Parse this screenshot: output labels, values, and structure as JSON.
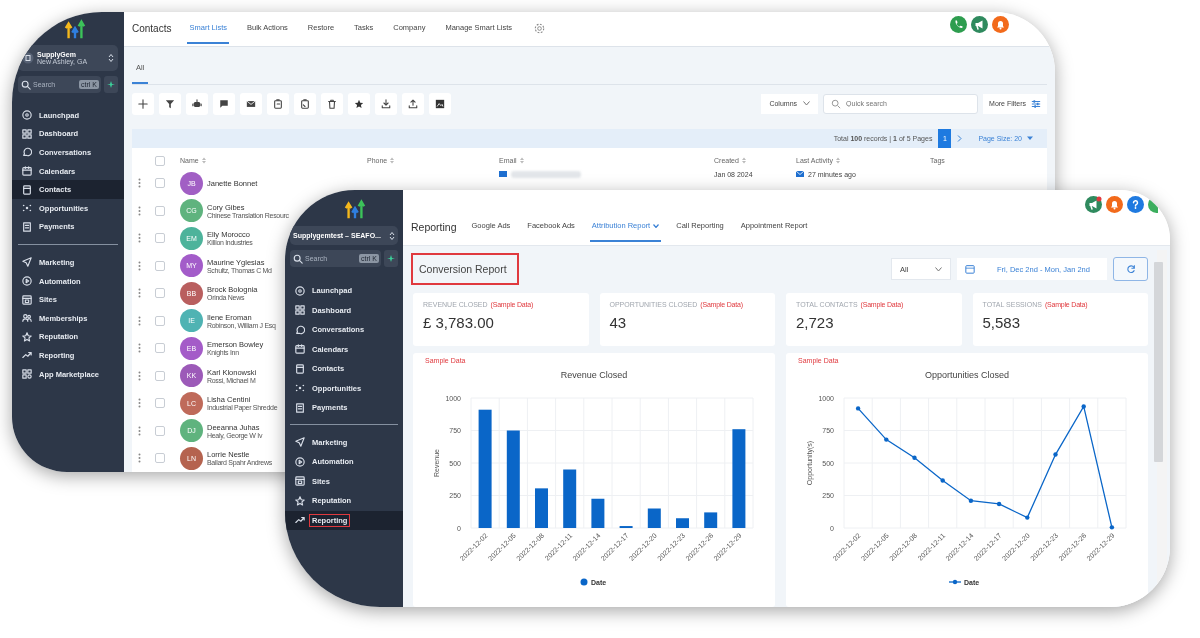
{
  "back_window": {
    "sidebar": {
      "account": {
        "name": "SupplyGem",
        "location": "New Ashley, GA"
      },
      "search": {
        "placeholder": "Search",
        "shortcut": "ctrl K"
      },
      "sections": [
        {
          "items": [
            {
              "label": "Launchpad",
              "selected": false
            },
            {
              "label": "Dashboard",
              "selected": false
            },
            {
              "label": "Conversations",
              "selected": false
            },
            {
              "label": "Calendars",
              "selected": false
            },
            {
              "label": "Contacts",
              "selected": true
            },
            {
              "label": "Opportunities",
              "selected": false
            },
            {
              "label": "Payments",
              "selected": false
            }
          ]
        },
        {
          "items": [
            {
              "label": "Marketing",
              "selected": false
            },
            {
              "label": "Automation",
              "selected": false
            },
            {
              "label": "Sites",
              "selected": false
            },
            {
              "label": "Memberships",
              "selected": false
            },
            {
              "label": "Reputation",
              "selected": false
            },
            {
              "label": "Reporting",
              "selected": false
            },
            {
              "label": "App Marketplace",
              "selected": false
            }
          ]
        }
      ]
    },
    "header": {
      "title": "Contacts",
      "tabs": [
        {
          "label": "Smart Lists",
          "selected": true
        },
        {
          "label": "Bulk Actions",
          "selected": false
        },
        {
          "label": "Restore",
          "selected": false
        },
        {
          "label": "Tasks",
          "selected": false
        },
        {
          "label": "Company",
          "selected": false
        },
        {
          "label": "Manage Smart Lists",
          "selected": false
        }
      ]
    },
    "subtabs": [
      {
        "label": "All",
        "selected": true
      }
    ],
    "toolbar": {
      "columns_button": "Columns",
      "search": {
        "placeholder": "Quick search"
      },
      "more_filters": "More Filters"
    },
    "pagination": {
      "summary": "Total **100** records | **1** of 5 Pages",
      "pages": [
        {
          "label": "1",
          "selected": true
        }
      ],
      "page_size": "Page Size: 20"
    },
    "table": {
      "all_checked": false,
      "columns": [
        {
          "label": "Name",
          "sortable": true
        },
        {
          "label": "Phone",
          "sortable": true
        },
        {
          "label": "Email",
          "sortable": true
        },
        {
          "label": "Created",
          "sortable": true
        },
        {
          "label": "Last Activity",
          "sortable": true
        },
        {
          "label": "Tags",
          "sortable": false
        }
      ],
      "rows": [
        {
          "checked": false,
          "initials": "JB",
          "color": "#a15fc4",
          "name": "Janette Bonnet",
          "created": "Jan 08 2024",
          "last_activity": "27 minutes ago"
        },
        {
          "checked": false,
          "initials": "CG",
          "color": "#5fb37e",
          "name": "Cory Gibes",
          "company": "Chinese Translation Resourc"
        },
        {
          "checked": false,
          "initials": "EM",
          "color": "#4db39b",
          "name": "Elly Morocco",
          "company": "Killion Industries"
        },
        {
          "checked": false,
          "initials": "MY",
          "color": "#a35cc9",
          "name": "Maurine Yglesias",
          "company": "Schultz, Thomas C Md"
        },
        {
          "checked": false,
          "initials": "BB",
          "color": "#b95f5f",
          "name": "Brock Bolognia",
          "company": "Orinda News"
        },
        {
          "checked": false,
          "initials": "IE",
          "color": "#4fb3b3",
          "name": "Ilene Eroman",
          "company": "Robinson, William J Esq"
        },
        {
          "checked": false,
          "initials": "EB",
          "color": "#a45bc8",
          "name": "Emerson Bowley",
          "company": "Knights Inn"
        },
        {
          "checked": false,
          "initials": "KK",
          "color": "#9c5ab8",
          "name": "Karl Klonowski",
          "company": "Rossi, Michael M"
        },
        {
          "checked": false,
          "initials": "LC",
          "color": "#bf6a5a",
          "name": "Lisha Centini",
          "company": "Industrial Paper Shredde"
        },
        {
          "checked": false,
          "initials": "DJ",
          "color": "#5fb37e",
          "name": "Deeanna Juhas",
          "company": "Healy, George W Iv"
        },
        {
          "checked": false,
          "initials": "LN",
          "color": "#b5634f",
          "name": "Lorrie Nestle",
          "company": "Ballard Spahr Andrews"
        }
      ]
    }
  },
  "front_window": {
    "sidebar": {
      "account": {
        "name": "Supplygemtest – SEAFO..."
      },
      "search": {
        "placeholder": "Search",
        "shortcut": "ctrl K"
      },
      "sections": [
        {
          "items": [
            {
              "label": "Launchpad",
              "selected": false,
              "highlighted": false
            },
            {
              "label": "Dashboard",
              "selected": false,
              "highlighted": false
            },
            {
              "label": "Conversations",
              "selected": false,
              "highlighted": false
            },
            {
              "label": "Calendars",
              "selected": false,
              "highlighted": false
            },
            {
              "label": "Contacts",
              "selected": false,
              "highlighted": false
            },
            {
              "label": "Opportunities",
              "selected": false,
              "highlighted": false
            },
            {
              "label": "Payments",
              "selected": false,
              "highlighted": false
            }
          ]
        },
        {
          "items": [
            {
              "label": "Marketing",
              "selected": false,
              "highlighted": false
            },
            {
              "label": "Automation",
              "selected": false,
              "highlighted": false
            },
            {
              "label": "Sites",
              "selected": false,
              "highlighted": false
            },
            {
              "label": "Reputation",
              "selected": false,
              "highlighted": false
            },
            {
              "label": "Reporting",
              "selected": true,
              "highlighted": true
            }
          ]
        }
      ]
    },
    "header": {
      "title": "Reporting",
      "tabs": [
        {
          "label": "Google Ads",
          "selected": false
        },
        {
          "label": "Facebook Ads",
          "selected": false
        },
        {
          "label": "Attribution Report",
          "selected": true,
          "dropdown": true
        },
        {
          "label": "Call Reporting",
          "selected": false
        },
        {
          "label": "Appointment Report",
          "selected": false
        }
      ]
    },
    "page_title": {
      "text": "Conversion Report",
      "highlighted": true
    },
    "filter": {
      "value": "All"
    },
    "date_range": "Fri, Dec 2nd - Mon, Jan 2nd",
    "stats": [
      {
        "label": "REVENUE CLOSED",
        "note": "(Sample Data)",
        "value": "£ 3,783.00"
      },
      {
        "label": "OPPORTUNITIES CLOSED",
        "note": "(Sample Data)",
        "value": "43"
      },
      {
        "label": "TOTAL CONTACTS",
        "note": "(Sample Data)",
        "value": "2,723"
      },
      {
        "label": "TOTAL SESSIONS",
        "note": "(Sample Data)",
        "value": "5,583"
      }
    ],
    "charts": [
      {
        "note": "Sample Data",
        "chart_data": {
          "type": "bar",
          "title": "Revenue Closed",
          "ylabel": "Revenue",
          "categories": [
            "2022-12-02",
            "2022-12-05",
            "2022-12-08",
            "2022-12-11",
            "2022-12-14",
            "2022-12-17",
            "2022-12-20",
            "2022-12-23",
            "2022-12-26",
            "2022-12-29"
          ],
          "series": [
            {
              "name": "Date",
              "color": "#0a66c8",
              "values": [
                910,
                750,
                305,
                450,
                225,
                15,
                150,
                75,
                120,
                760
              ]
            }
          ],
          "ylim": [
            0,
            1000
          ],
          "yticks": [
            0,
            250,
            500,
            750,
            1000
          ],
          "grid": true
        }
      },
      {
        "note": "Sample Data",
        "chart_data": {
          "type": "line",
          "title": "Opportunities Closed",
          "ylabel": "Opportunity(s)",
          "categories": [
            "2022-12-02",
            "2022-12-05",
            "2022-12-08",
            "2022-12-11",
            "2022-12-14",
            "2022-12-17",
            "2022-12-20",
            "2022-12-23",
            "2022-12-26",
            "2022-12-29"
          ],
          "series": [
            {
              "name": "Date",
              "color": "#0a66c8",
              "values": [
                920,
                680,
                540,
                365,
                210,
                185,
                80,
                565,
                935,
                5
              ]
            }
          ],
          "ylim": [
            0,
            1000
          ],
          "yticks": [
            0,
            250,
            500,
            750,
            1000
          ],
          "grid": true
        }
      }
    ]
  }
}
